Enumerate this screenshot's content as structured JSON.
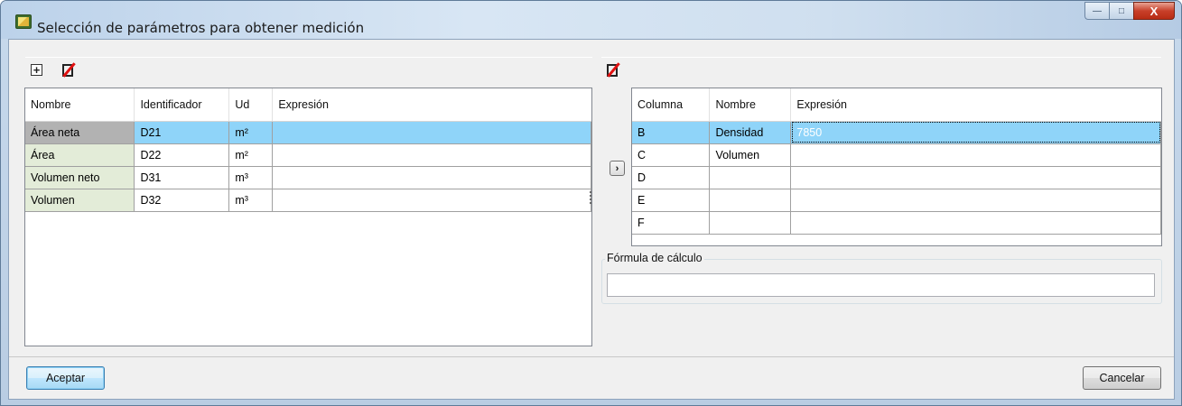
{
  "window": {
    "title": "Selección de parámetros para obtener medición",
    "minimize_glyph": "—",
    "maximize_glyph": "□",
    "close_glyph": "X"
  },
  "left_toolbar": {
    "add_icon_glyph": "+",
    "icons": [
      "add-row-icon",
      "delete-icon"
    ]
  },
  "parameters_table": {
    "headers": [
      "Nombre",
      "Identificador",
      "Ud",
      "Expresión"
    ],
    "rows": [
      {
        "name": "Área neta",
        "id": "D21",
        "unit": "m²",
        "expr": "",
        "selected": true
      },
      {
        "name": "Área",
        "id": "D22",
        "unit": "m²",
        "expr": ""
      },
      {
        "name": "Volumen neto",
        "id": "D31",
        "unit": "m³",
        "expr": ""
      },
      {
        "name": "Volumen",
        "id": "D32",
        "unit": "m³",
        "expr": ""
      }
    ]
  },
  "transfer_button": {
    "glyph": "›"
  },
  "columns_table": {
    "headers": [
      "Columna",
      "Nombre",
      "Expresión"
    ],
    "rows": [
      {
        "col": "B",
        "name": "Densidad",
        "expr": "7850",
        "selected": true
      },
      {
        "col": "C",
        "name": "Volumen",
        "expr": ""
      },
      {
        "col": "D",
        "name": "",
        "expr": ""
      },
      {
        "col": "E",
        "name": "",
        "expr": ""
      },
      {
        "col": "F",
        "name": "",
        "expr": ""
      }
    ]
  },
  "formula": {
    "label": "Fórmula de cálculo",
    "value": ""
  },
  "buttons": {
    "accept": "Aceptar",
    "cancel": "Cancelar"
  },
  "colors": {
    "selected_row": "#8fd4f9",
    "selected_cell": "#3399ff",
    "name_cell": "#e3ecd8",
    "close_button": "#c8402a"
  }
}
